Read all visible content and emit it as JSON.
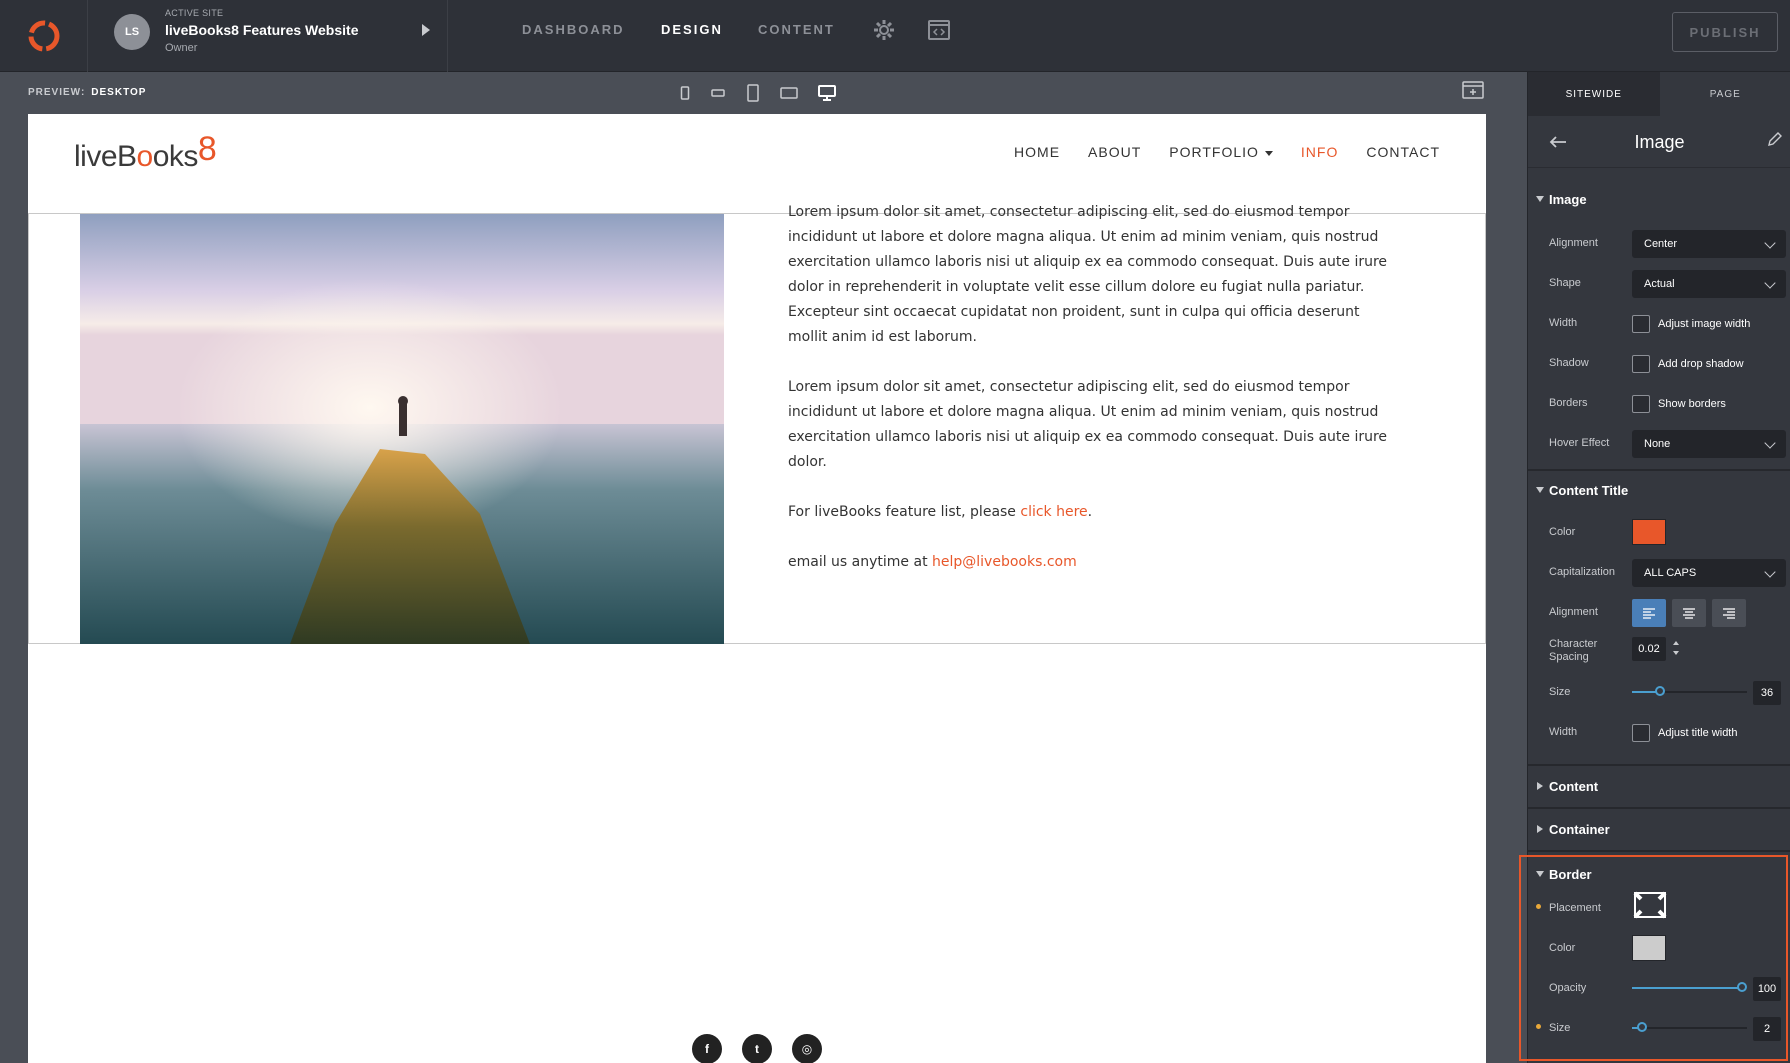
{
  "topbar": {
    "active_site_label": "ACTIVE SITE",
    "site_name": "liveBooks8 Features Website",
    "site_role": "Owner",
    "avatar_initials": "LS",
    "tabs": [
      {
        "label": "DASHBOARD",
        "active": false
      },
      {
        "label": "DESIGN",
        "active": true
      },
      {
        "label": "CONTENT",
        "active": false
      }
    ],
    "publish_label": "PUBLISH"
  },
  "preview": {
    "label": "PREVIEW:",
    "mode": "DESKTOP"
  },
  "site": {
    "brand": {
      "part1": "liveB",
      "o1": "o",
      "part2": "oks",
      "eight": "8"
    },
    "nav": [
      {
        "label": "HOME",
        "active": false
      },
      {
        "label": "ABOUT",
        "active": false
      },
      {
        "label": "PORTFOLIO",
        "active": false,
        "dropdown": true
      },
      {
        "label": "INFO",
        "active": true
      },
      {
        "label": "CONTACT",
        "active": false
      }
    ],
    "paragraph1": "Lorem ipsum dolor sit amet, consectetur adipiscing elit, sed do eiusmod tempor incididunt ut labore et dolore magna aliqua. Ut enim ad minim veniam, quis nostrud exercitation ullamco laboris nisi ut aliquip ex ea commodo consequat. Duis aute irure dolor in reprehenderit in voluptate velit esse cillum dolore eu fugiat nulla pariatur. Excepteur sint occaecat cupidatat non proident, sunt in culpa qui officia deserunt mollit anim id est laborum.",
    "paragraph2": "Lorem ipsum dolor sit amet, consectetur adipiscing elit, sed do eiusmod tempor incididunt ut labore et dolore magna aliqua. Ut enim ad minim veniam, quis nostrud exercitation ullamco laboris nisi ut aliquip ex ea commodo consequat. Duis aute irure dolor.",
    "feature_prefix": "For liveBooks feature list, please ",
    "feature_link": "click here",
    "feature_suffix": ".",
    "email_prefix": "email us anytime at ",
    "email_link": "help@livebooks.com",
    "social": [
      {
        "icon": "facebook-icon",
        "glyph": "f"
      },
      {
        "icon": "twitter-icon",
        "glyph": "t"
      },
      {
        "icon": "instagram-icon",
        "glyph": "◎"
      }
    ]
  },
  "panel": {
    "tabs": [
      {
        "label": "SITEWIDE",
        "active": true
      },
      {
        "label": "PAGE",
        "active": false
      }
    ],
    "title": "Image",
    "image_section": {
      "title": "Image",
      "alignment_label": "Alignment",
      "alignment_value": "Center",
      "shape_label": "Shape",
      "shape_value": "Actual",
      "width_label": "Width",
      "width_check": "Adjust image width",
      "shadow_label": "Shadow",
      "shadow_check": "Add drop shadow",
      "borders_label": "Borders",
      "borders_check": "Show borders",
      "hover_label": "Hover Effect",
      "hover_value": "None"
    },
    "content_title_section": {
      "title": "Content Title",
      "color_label": "Color",
      "color_value": "#e8572a",
      "cap_label": "Capitalization",
      "cap_value": "ALL CAPS",
      "align_label": "Alignment",
      "spacing_label_1": "Character",
      "spacing_label_2": "Spacing",
      "spacing_value": "0.02",
      "size_label": "Size",
      "size_value": "36",
      "width_label": "Width",
      "width_check": "Adjust title width"
    },
    "content_section": {
      "title": "Content"
    },
    "container_section": {
      "title": "Container"
    },
    "border_section": {
      "title": "Border",
      "placement_label": "Placement",
      "color_label": "Color",
      "color_value": "#cccccc",
      "opacity_label": "Opacity",
      "opacity_value": "100",
      "size_label": "Size",
      "size_value": "2"
    }
  },
  "colors": {
    "accent": "#e8572a",
    "slider": "#4a9fd0",
    "active_align": "#4a7fb8"
  }
}
